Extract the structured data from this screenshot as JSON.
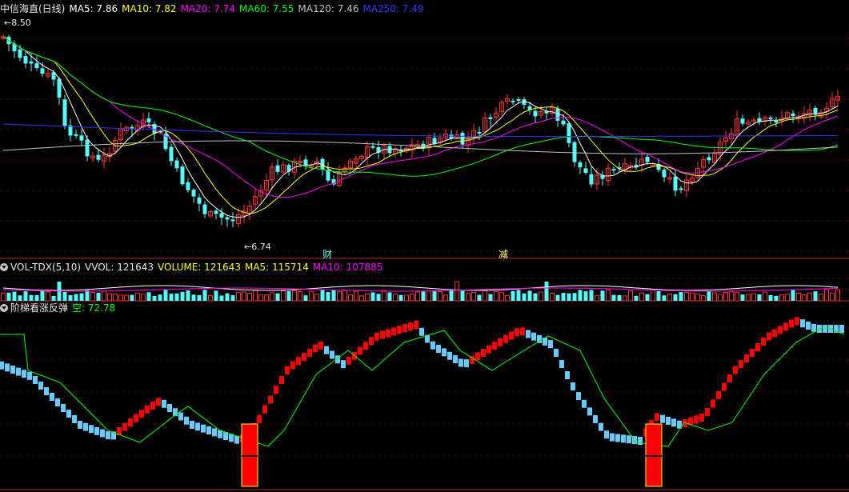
{
  "main_header": {
    "stock": "中信海直(日线)",
    "ma5": "MA5: 7.86",
    "ma10": "MA10: 7.82",
    "ma20": "MA20: 7.74",
    "ma60": "MA60: 7.55",
    "ma120": "MA120: 7.46",
    "ma250": "MA250: 7.49"
  },
  "price_labels": {
    "high": "8.50",
    "low": "6.74"
  },
  "event_markers": [
    "财",
    "减"
  ],
  "vol_header": {
    "name": "VOL-TDX(5,10)",
    "vvol": "VVOL: 121643",
    "volume": "VOLUME: 121643",
    "ma5": "MA5: 115714",
    "ma10": "MA10: 107885"
  },
  "ind_header": {
    "name": "阶梯看涨反弹",
    "kong": "空: 72.78"
  },
  "colors": {
    "up": "#ff3232",
    "down": "#54fcfc",
    "ma5": "#ffffff",
    "ma10": "#ffff00",
    "ma20": "#ff00ff",
    "ma60": "#00ff00",
    "ma120": "#c0c0c0",
    "ma250": "#3333ff",
    "grid": "#8b0000",
    "frame": "#b4232a",
    "ladder_up": "#ff0000",
    "ladder_down": "#66ccff",
    "box": "#ffff00"
  }
}
